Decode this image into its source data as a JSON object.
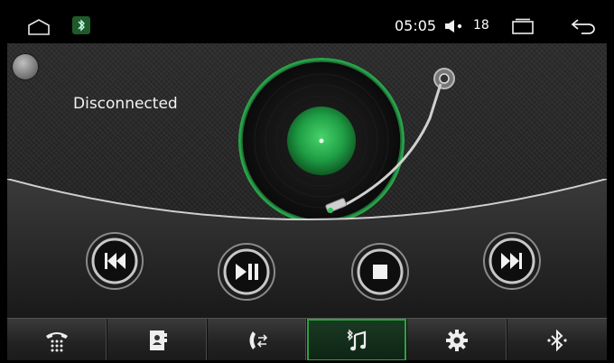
{
  "status_bar": {
    "time": "05:05",
    "volume": "18",
    "icons": [
      "home-icon",
      "bluetooth-icon",
      "volume-icon",
      "recent-apps-icon",
      "back-icon"
    ]
  },
  "player": {
    "connection_status": "Disconnected",
    "icons": [
      "status-dot-icon",
      "turntable-icon"
    ]
  },
  "controls": [
    {
      "name": "previous-button",
      "icon": "skip-previous-icon"
    },
    {
      "name": "play-pause-button",
      "icon": "play-pause-icon"
    },
    {
      "name": "stop-button",
      "icon": "stop-icon"
    },
    {
      "name": "next-button",
      "icon": "skip-next-icon"
    }
  ],
  "nav": [
    {
      "name": "nav-dialpad",
      "icon": "dialpad-icon",
      "active": false
    },
    {
      "name": "nav-contacts",
      "icon": "contacts-icon",
      "active": false
    },
    {
      "name": "nav-call-log",
      "icon": "call-transfer-icon",
      "active": false
    },
    {
      "name": "nav-music",
      "icon": "bluetooth-music-icon",
      "active": true
    },
    {
      "name": "nav-settings",
      "icon": "gear-icon",
      "active": false
    },
    {
      "name": "nav-bluetooth",
      "icon": "bluetooth-icon",
      "active": false
    }
  ],
  "colors": {
    "accent": "#2ea043",
    "disc_green": "#1f9e45",
    "background": "#222222",
    "status_bar": "#000000"
  }
}
